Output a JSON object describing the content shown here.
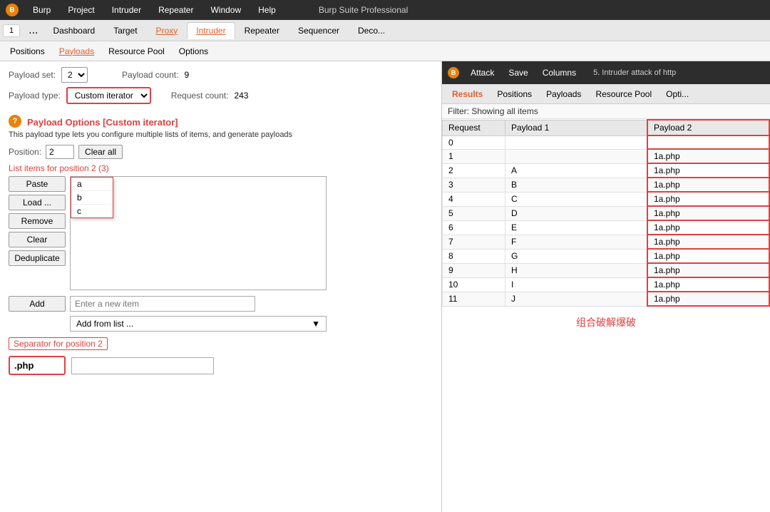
{
  "topMenuBar": {
    "logoText": "B",
    "menus": [
      "Burp",
      "Project",
      "Intruder",
      "Repeater",
      "Window",
      "Help"
    ],
    "appTitle": "Burp Suite Professional"
  },
  "tabBar": {
    "tabs": [
      "Dashboard",
      "Target",
      "Proxy",
      "Intruder",
      "Repeater",
      "Sequencer",
      "Deco..."
    ],
    "activeTab": "Intruder",
    "tabNumber": "1",
    "tabDots": "..."
  },
  "subTabBar": {
    "tabs": [
      "Positions",
      "Payloads",
      "Resource Pool",
      "Options"
    ],
    "activeTab": "Payloads"
  },
  "leftPanel": {
    "payloadSetLabel": "Payload set:",
    "payloadSetValue": "2",
    "payloadCountLabel": "Payload count:",
    "payloadCountValue": "9",
    "payloadTypeLabel": "Payload type:",
    "payloadTypeValue": "Custom iterator",
    "requestCountLabel": "Request count:",
    "requestCountValue": "243",
    "sectionTitle": "Payload Options [Custom iterator]",
    "sectionDesc": "This payload type lets you configure multiple lists of items, and generate payloads",
    "positionLabel": "Position:",
    "positionValue": "2",
    "clearAllLabel": "Clear all",
    "listHeader": "List items for position 2 (3)",
    "listItems": [
      "a",
      "b",
      "c"
    ],
    "buttons": {
      "paste": "Paste",
      "load": "Load ...",
      "remove": "Remove",
      "clear": "Clear",
      "deduplicate": "Deduplicate",
      "add": "Add",
      "addFromList": "Add from list ..."
    },
    "addInputPlaceholder": "Enter a new item",
    "separatorLabel": "Separator for position 2",
    "separatorValue": ".php"
  },
  "rightPanel": {
    "toolbar": {
      "logoText": "B",
      "menus": [
        "Attack",
        "Save",
        "Columns"
      ],
      "windowTitle": "5. Intruder attack of http"
    },
    "tabs": [
      "Results",
      "Positions",
      "Payloads",
      "Resource Pool",
      "Opti..."
    ],
    "activeTab": "Results",
    "filterText": "Filter: Showing all items",
    "tableHeaders": [
      "Request",
      "Payload 1",
      "Payload 2"
    ],
    "tableRows": [
      {
        "request": "0",
        "payload1": "",
        "payload2": ""
      },
      {
        "request": "1",
        "payload1": "",
        "payload2": "1a.php"
      },
      {
        "request": "2",
        "payload1": "A",
        "payload2": "1a.php"
      },
      {
        "request": "3",
        "payload1": "B",
        "payload2": "1a.php"
      },
      {
        "request": "4",
        "payload1": "C",
        "payload2": "1a.php"
      },
      {
        "request": "5",
        "payload1": "D",
        "payload2": "1a.php"
      },
      {
        "request": "6",
        "payload1": "E",
        "payload2": "1a.php"
      },
      {
        "request": "7",
        "payload1": "F",
        "payload2": "1a.php"
      },
      {
        "request": "8",
        "payload1": "G",
        "payload2": "1a.php"
      },
      {
        "request": "9",
        "payload1": "H",
        "payload2": "1a.php"
      },
      {
        "request": "10",
        "payload1": "I",
        "payload2": "1a.php"
      },
      {
        "request": "11",
        "payload1": "J",
        "payload2": "1a.php"
      }
    ],
    "chineseText": "组合破解爆破"
  }
}
